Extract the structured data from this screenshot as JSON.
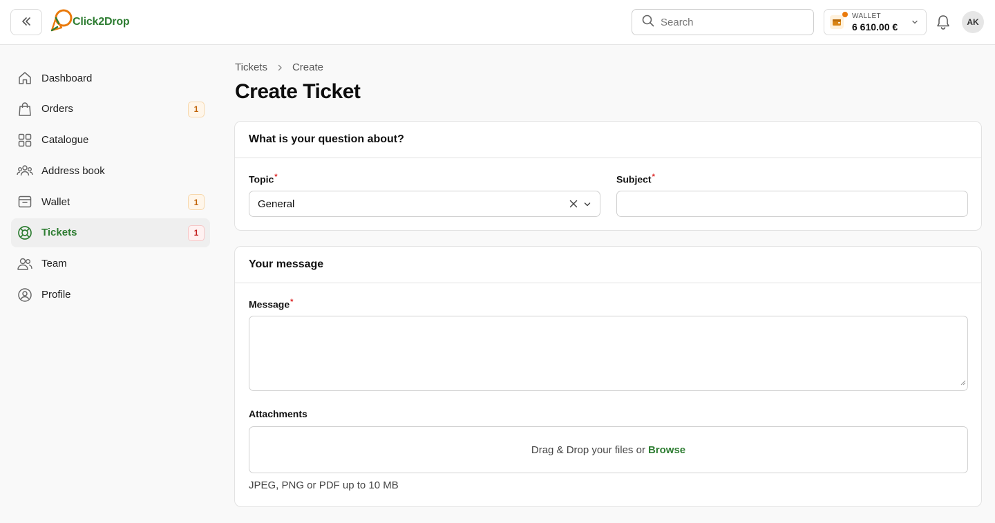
{
  "brand": {
    "name": "Click2Drop",
    "accent": "#2e7d32",
    "logo_orange": "#ea7a0c"
  },
  "header": {
    "search_placeholder": "Search",
    "wallet": {
      "label": "WALLET",
      "amount": "6 610.00 €"
    },
    "avatar_initials": "AK",
    "icons": [
      "double-chevron-left-icon",
      "search-icon",
      "wallet-icon",
      "chevron-down-icon",
      "bell-icon"
    ]
  },
  "sidebar": {
    "items": [
      {
        "label": "Dashboard",
        "icon": "home-icon",
        "badge": null,
        "active": false
      },
      {
        "label": "Orders",
        "icon": "shopping-bag-icon",
        "badge": "1",
        "badge_color": "#c2650a",
        "active": false
      },
      {
        "label": "Catalogue",
        "icon": "grid-icon",
        "badge": null,
        "active": false
      },
      {
        "label": "Address book",
        "icon": "users-group-icon",
        "badge": null,
        "active": false
      },
      {
        "label": "Wallet",
        "icon": "archive-box-icon",
        "badge": "1",
        "badge_color": "#c2650a",
        "active": false
      },
      {
        "label": "Tickets",
        "icon": "lifebuoy-icon",
        "badge": "1",
        "badge_color": "#c52222",
        "active": true
      },
      {
        "label": "Team",
        "icon": "users-icon",
        "badge": null,
        "active": false
      },
      {
        "label": "Profile",
        "icon": "user-circle-icon",
        "badge": null,
        "active": false
      }
    ]
  },
  "breadcrumb": {
    "parent": "Tickets",
    "current": "Create"
  },
  "page": {
    "title": "Create Ticket"
  },
  "question_card": {
    "title": "What is your question about?",
    "topic_label": "Topic",
    "topic_value": "General",
    "subject_label": "Subject",
    "subject_value": "",
    "required_mark": "*"
  },
  "message_card": {
    "title": "Your message",
    "message_label": "Message",
    "message_value": "",
    "attachments_label": "Attachments",
    "dropzone_text": "Drag & Drop your files or",
    "browse_label": "Browse",
    "hint": "JPEG, PNG or PDF up to 10 MB"
  }
}
